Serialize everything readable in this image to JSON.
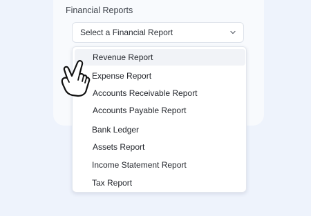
{
  "form": {
    "label": "Financial Reports",
    "select": {
      "value": "Select a Financial Report",
      "icon": "chevron-down-icon"
    }
  },
  "dropdown": {
    "items": [
      {
        "label": "Revenue Report",
        "highlighted": true
      },
      {
        "label": "Expense Report"
      },
      {
        "label": "Accounts Receivable Report"
      },
      {
        "label": "Accounts Payable Report"
      },
      {
        "label": "Bank Ledger"
      },
      {
        "label": "Assets Report"
      },
      {
        "label": "Income Statement Report"
      },
      {
        "label": "Tax Report"
      }
    ]
  },
  "cursor": {
    "icon": "pointing-hand-icon"
  },
  "colors": {
    "background": "#eef3fc",
    "card": "#f8fafd",
    "highlight": "#f1f3f7"
  }
}
